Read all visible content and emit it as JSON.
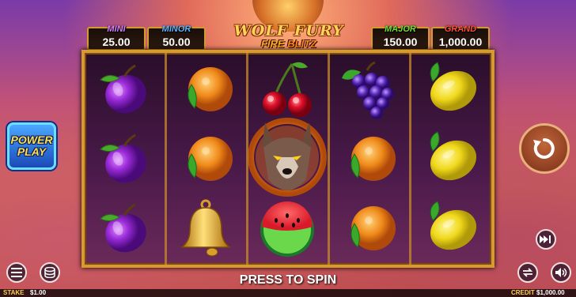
{
  "jackpots": {
    "mini": {
      "label": "MINI",
      "value": "25.00"
    },
    "minor": {
      "label": "MINOR",
      "value": "50.00"
    },
    "major": {
      "label": "MAJOR",
      "value": "150.00"
    },
    "grand": {
      "label": "GRAND",
      "value": "1,000.00"
    }
  },
  "logo": {
    "line1": "WOLF FURY",
    "fire": "FIRE",
    "blitz": "BLITZ"
  },
  "power_play": {
    "line1": "POWER",
    "line2": "PLAY"
  },
  "spin_prompt": "PRESS TO SPIN",
  "footer": {
    "stake_label": "STAKE",
    "stake_value": "$1.00",
    "credit_label": "CREDIT",
    "credit_value": "$1,000.00"
  },
  "reels": [
    [
      "plum",
      "plum",
      "plum"
    ],
    [
      "orange",
      "orange",
      "bell"
    ],
    [
      "cherry",
      "wolf",
      "watermelon"
    ],
    [
      "grapes",
      "orange",
      "orange"
    ],
    [
      "lemon",
      "lemon",
      "lemon"
    ]
  ],
  "colors": {
    "frame_gold": "#d89a2c",
    "accent_orange": "#ffb020"
  }
}
